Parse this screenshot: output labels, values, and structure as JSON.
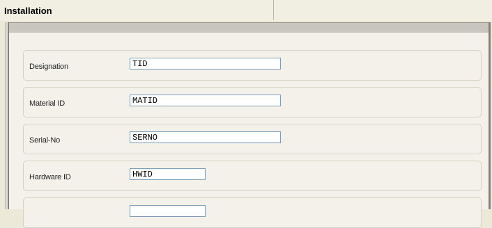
{
  "header": {
    "title": "Installation"
  },
  "fields": [
    {
      "label": "Designation",
      "value": "TID"
    },
    {
      "label": "Material ID",
      "value": "MATID"
    },
    {
      "label": "Serial-No",
      "value": "SERNO"
    },
    {
      "label": "Hardware ID",
      "value": "HWID"
    },
    {
      "label": "",
      "value": ""
    }
  ]
}
